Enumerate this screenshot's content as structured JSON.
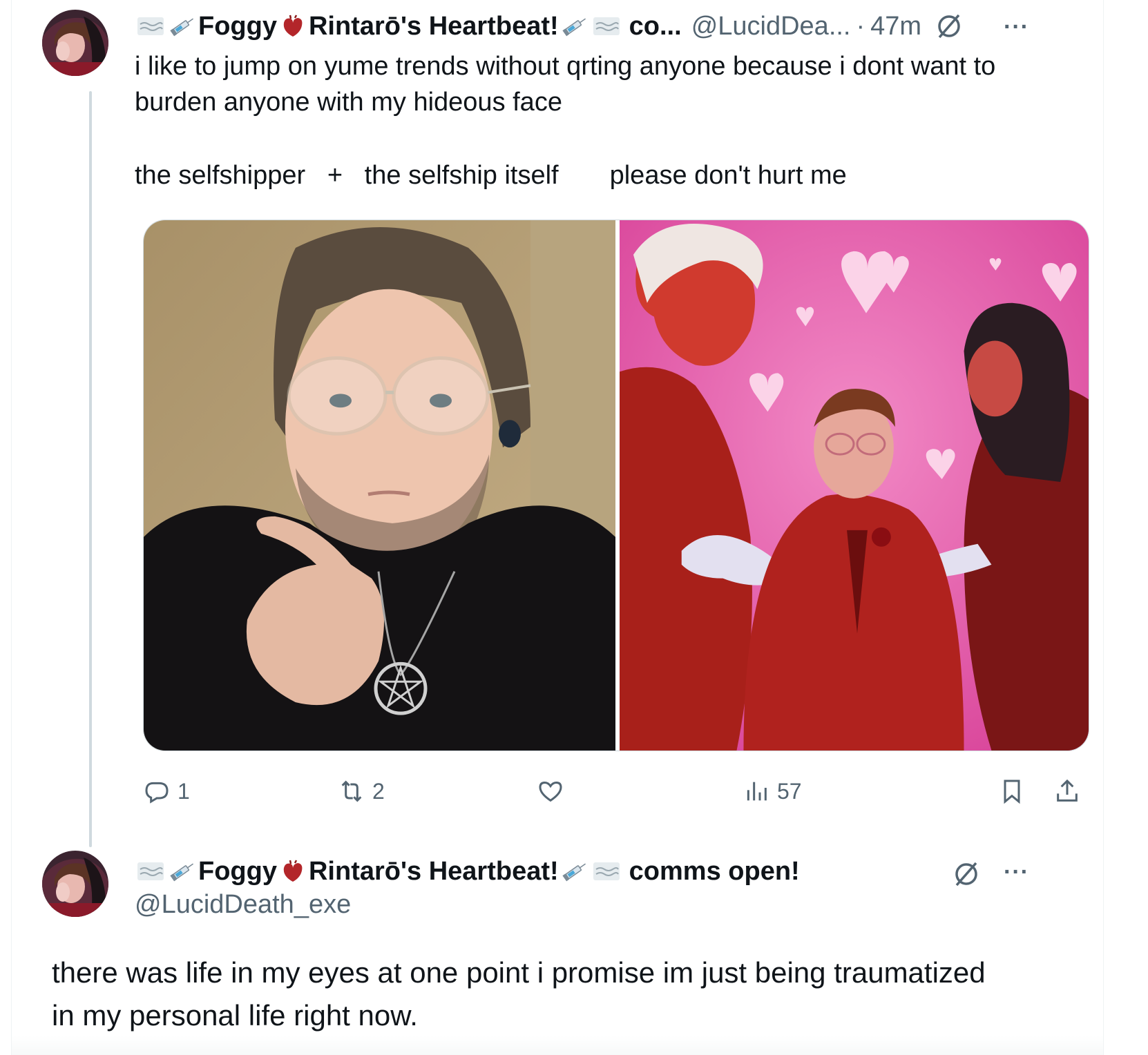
{
  "tweet1": {
    "display_name_parts": [
      "Foggy",
      "Rintarō's Heartbeat!",
      "co..."
    ],
    "handle": "@LucidDea...",
    "separator": "·",
    "time": "47m",
    "more": "···",
    "text_line1": "i like to jump on yume trends without qrting anyone because i dont want to",
    "text_line2": "burden anyone with my hideous face",
    "text_line3a": "the selfshipper   +   the selfship itself",
    "text_line3b": "please don't hurt me",
    "media": [
      {
        "alt": "selfie photo"
      },
      {
        "alt": "illustrated art with hearts"
      }
    ],
    "actions": {
      "reply_count": "1",
      "retweet_count": "2",
      "like_count": "",
      "views_count": "57"
    }
  },
  "tweet2": {
    "display_name_parts": [
      "Foggy",
      "Rintarō's Heartbeat!",
      "comms open!"
    ],
    "handle": "@LucidDeath_exe",
    "more": "···",
    "text_line1": "there was life in my eyes at one point i promise im just being traumatized",
    "text_line2": "in my personal life right now."
  },
  "icons": {
    "emoji_wave": "fog-emoji-icon",
    "emoji_syringe": "syringe-emoji-icon",
    "emoji_heart": "anatomical-heart-emoji-icon",
    "emoji_hand_heart": "heart-hands-emoji-icon",
    "verified_slash": "circle-slash-icon",
    "reply": "reply-icon",
    "retweet": "retweet-icon",
    "like": "heart-icon",
    "views": "views-icon",
    "bookmark": "bookmark-icon",
    "share": "share-icon"
  },
  "colors": {
    "text": "#0f1419",
    "secondary": "#536471",
    "thread_line": "#cfd9de",
    "art_pink": "#e35aa5",
    "art_red": "#a8201a"
  }
}
